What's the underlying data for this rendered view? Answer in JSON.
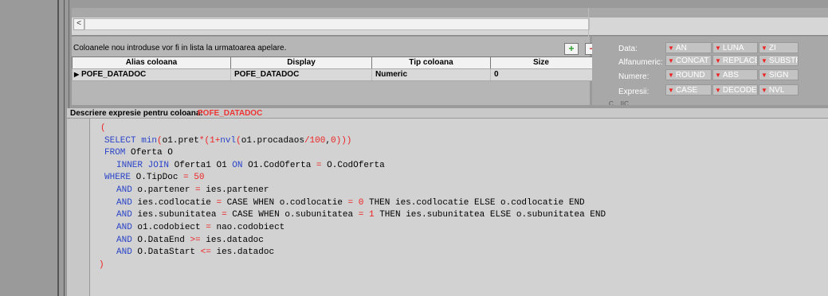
{
  "notice": "Coloanele nou introduse vor fi in lista la urmatoarea apelare.",
  "scroll_left_glyph": "<",
  "buttons": {
    "add": "+",
    "remove": "−"
  },
  "grid": {
    "headers": [
      "Alias coloana",
      "Display",
      "Tip coloana",
      "Size"
    ],
    "row": {
      "marker": "▶",
      "cells": [
        "POFE_DATADOC",
        "POFE_DATADOC",
        "Numeric",
        "0"
      ]
    }
  },
  "functions": {
    "rows": [
      {
        "label": "Data:",
        "items": [
          "AN",
          "LUNA",
          "ZI"
        ]
      },
      {
        "label": "Alfanumeric:",
        "items": [
          "CONCAT",
          "REPLACE",
          "SUBSTR"
        ]
      },
      {
        "label": "Numere:",
        "items": [
          "ROUND",
          "ABS",
          "SIGN"
        ]
      },
      {
        "label": "Expresii:",
        "items": [
          "CASE",
          "DECODE",
          "NVL"
        ]
      }
    ],
    "truncated_label": "C... IIC..."
  },
  "description": {
    "label": "Descriere expresie pentru coloana:",
    "column": "POFE_DATADOC"
  },
  "code_lines": [
    "(",
    "SELECT min(o1.pret*(1+nvl(o1.procadaos/100,0)))",
    "FROM Oferta O",
    "INNER JOIN Oferta1 O1 ON O1.CodOferta = O.CodOferta",
    "WHERE O.TipDoc = 50",
    "AND o.partener = ies.partener",
    "AND ies.codlocatie = CASE WHEN o.codlocatie = 0 THEN ies.codlocatie ELSE o.codlocatie END",
    "AND ies.subunitatea = CASE WHEN o.subunitatea = 1 THEN ies.subunitatea ELSE o.subunitatea END",
    "AND o1.codobiect = nao.codobiect",
    "AND O.DataEnd >= ies.datadoc",
    "AND O.DataStart <= ies.datadoc",
    ")"
  ],
  "colors": {
    "keyword": "#2a44c8",
    "operator": "#e22222",
    "accent_red": "#e33333"
  }
}
